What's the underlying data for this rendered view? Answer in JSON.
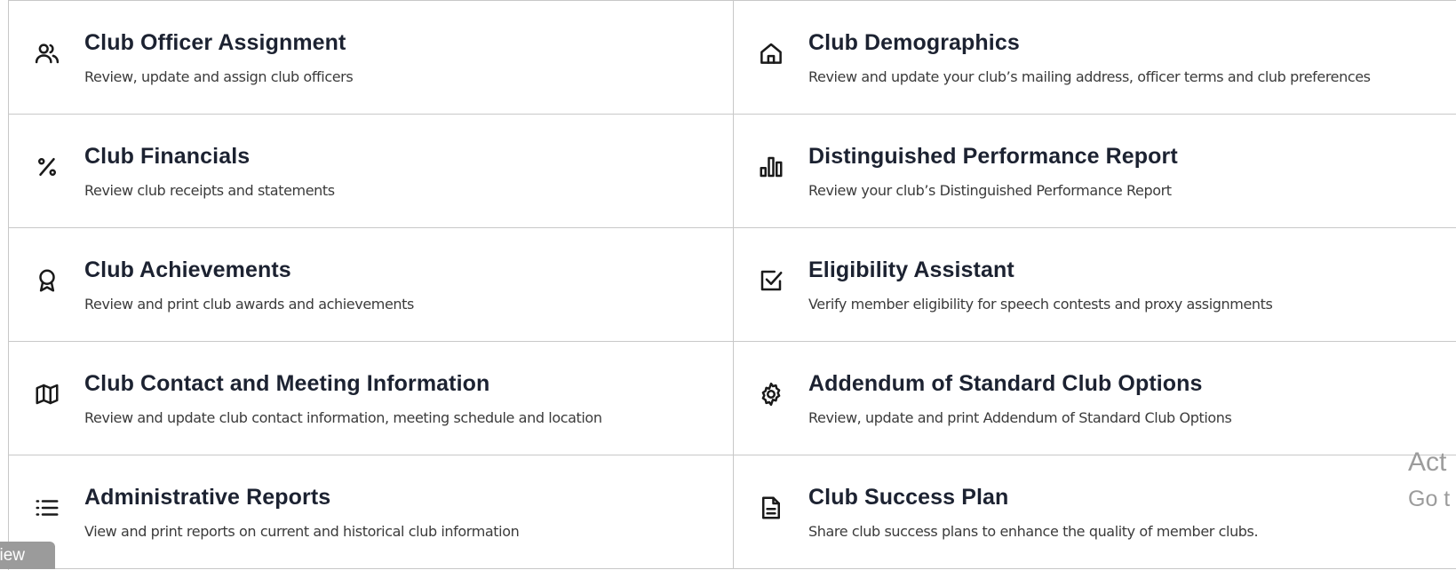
{
  "tiles": [
    {
      "title": "Club Officer Assignment",
      "desc": "Review, update and assign club officers",
      "icon": "users-icon"
    },
    {
      "title": "Club Demographics",
      "desc": "Review and update your club’s mailing address, officer terms and club preferences",
      "icon": "home-icon"
    },
    {
      "title": "Club Financials",
      "desc": "Review club receipts and statements",
      "icon": "percent-icon"
    },
    {
      "title": "Distinguished Performance Report",
      "desc": "Review your club’s Distinguished Performance Report",
      "icon": "bar-chart-icon"
    },
    {
      "title": "Club Achievements",
      "desc": "Review and print club awards and achievements",
      "icon": "award-icon"
    },
    {
      "title": "Eligibility Assistant",
      "desc": "Verify member eligibility for speech contests and proxy assignments",
      "icon": "checkbox-icon"
    },
    {
      "title": "Club Contact and Meeting Information",
      "desc": "Review and update club contact information, meeting schedule and location",
      "icon": "map-icon"
    },
    {
      "title": "Addendum of Standard Club Options",
      "desc": "Review, update and print Addendum of Standard Club Options",
      "icon": "gear-icon"
    },
    {
      "title": "Administrative Reports",
      "desc": "View and print reports on current and historical club information",
      "icon": "list-icon"
    },
    {
      "title": "Club Success Plan",
      "desc": "Share club success plans to enhance the quality of member clubs.",
      "icon": "document-icon"
    }
  ],
  "watermark": {
    "line1": "Act",
    "line2": "Go t"
  },
  "badge": {
    "label": "view"
  }
}
